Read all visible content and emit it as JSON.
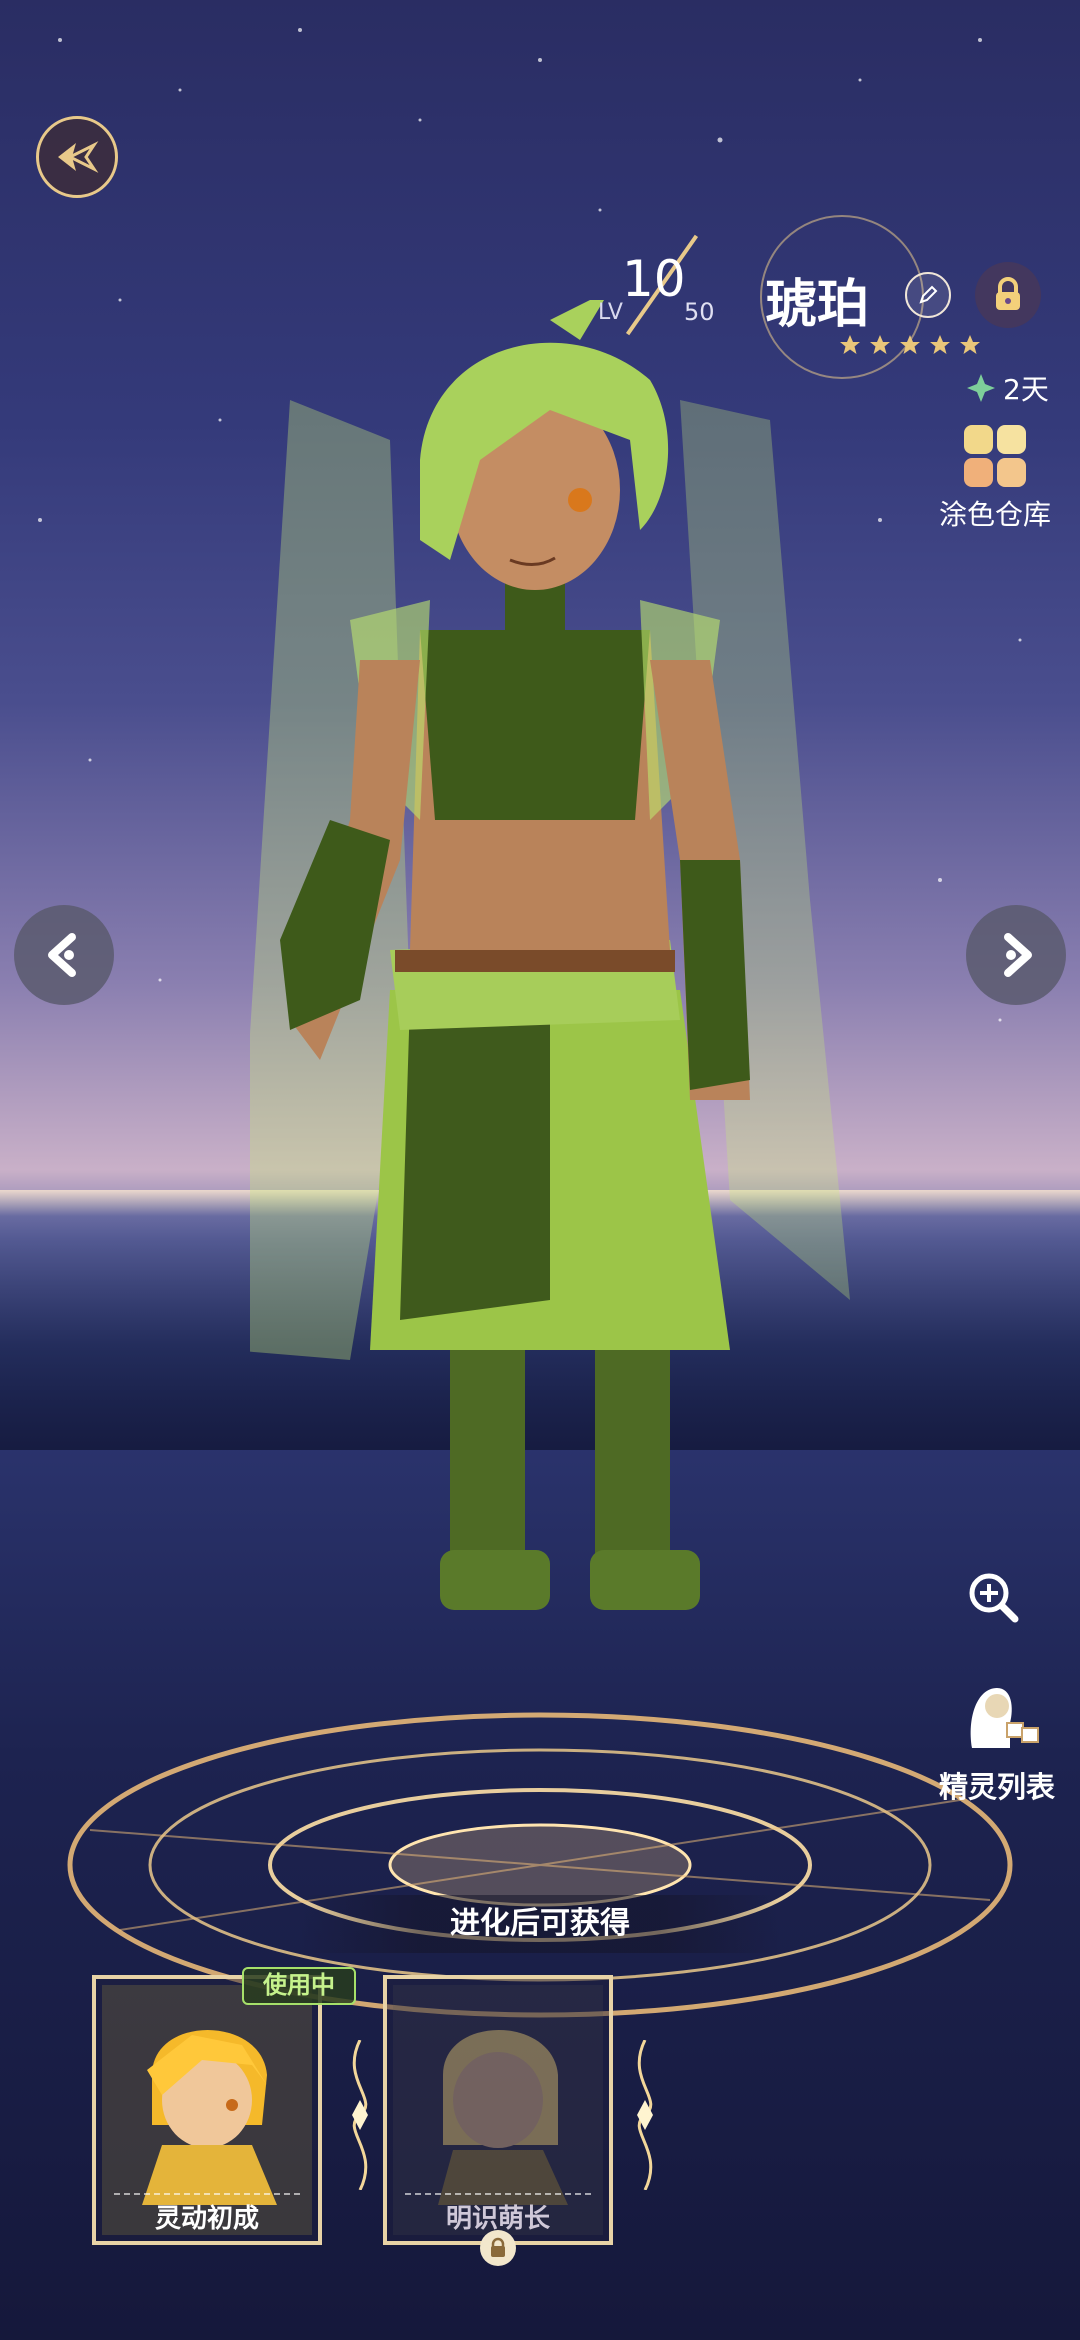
{
  "level": {
    "lv_label": "LV",
    "current": "10",
    "max": "50"
  },
  "character": {
    "name": "琥珀",
    "stars": 5
  },
  "status": {
    "days": "2天"
  },
  "paint_storage": {
    "label": "涂色仓库",
    "colors": [
      "#f2d88a",
      "#f6e2a0",
      "#f0b07a",
      "#f3c68c"
    ]
  },
  "spirit_list": {
    "label": "精灵列表"
  },
  "evolve": {
    "label": "进化后可获得"
  },
  "outfits": [
    {
      "name": "灵动初成",
      "badge": "使用中",
      "status": "in-use"
    },
    {
      "name": "明识萌长",
      "status": "locked"
    }
  ],
  "icons": {
    "back": "wing-back-icon",
    "edit": "pencil-edit-icon",
    "lock": "padlock-icon",
    "days": "clover-icon",
    "zoom": "zoom-in-icon",
    "prev": "chevron-left-icon",
    "next": "chevron-right-icon"
  },
  "colors": {
    "accent_gold": "#e8c98a",
    "in_use_green": "#a6e06a"
  }
}
